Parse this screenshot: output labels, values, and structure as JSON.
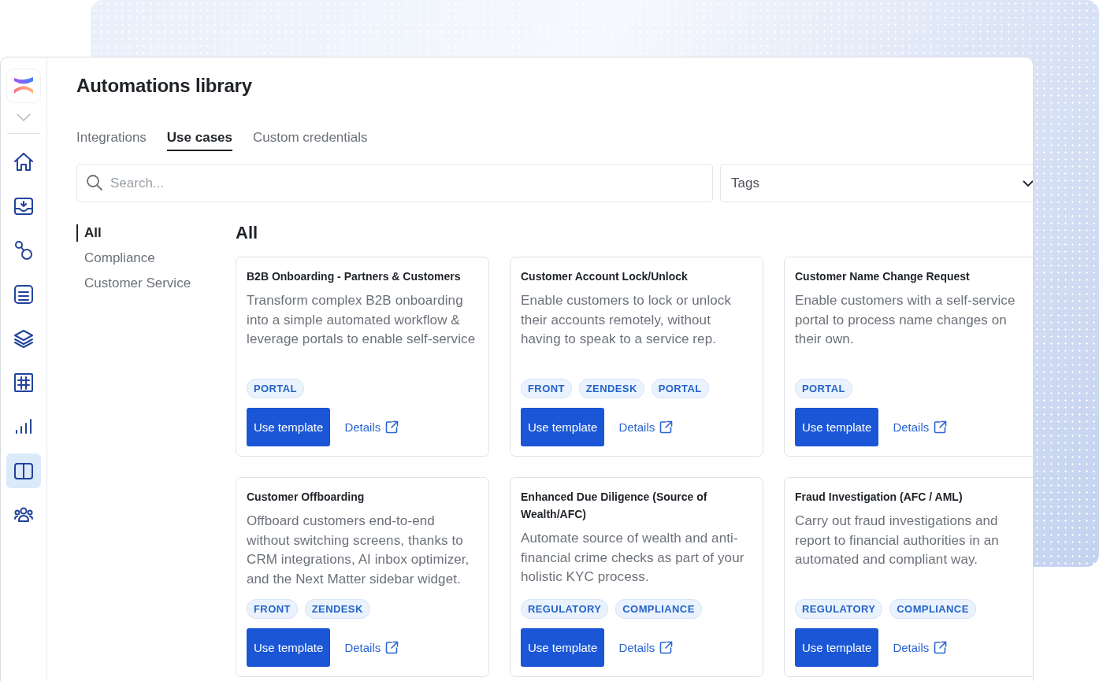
{
  "sidebar": {
    "items": [
      {
        "kind": "home",
        "selected": false
      },
      {
        "kind": "inbox",
        "selected": false
      },
      {
        "kind": "flow",
        "selected": false
      },
      {
        "kind": "list",
        "selected": false
      },
      {
        "kind": "layers",
        "selected": false
      },
      {
        "kind": "grid",
        "selected": false
      },
      {
        "kind": "chart",
        "selected": false
      },
      {
        "kind": "book",
        "selected": true
      },
      {
        "kind": "team",
        "selected": false
      }
    ]
  },
  "title": "Automations library",
  "tabs": [
    {
      "label": "Integrations",
      "selected": false
    },
    {
      "label": "Use cases",
      "selected": true
    },
    {
      "label": "Custom credentials",
      "selected": false
    }
  ],
  "search": {
    "placeholder": "Search..."
  },
  "tags_filter": {
    "label": "Tags"
  },
  "categories": [
    {
      "label": "All",
      "selected": true
    },
    {
      "label": "Compliance",
      "selected": false
    },
    {
      "label": "Customer Service",
      "selected": false
    }
  ],
  "section_title": "All",
  "cards": [
    {
      "title": "B2B Onboarding - Partners & Customers",
      "description": "Transform complex B2B onboarding into a simple automated workflow & leverage portals to enable self-service",
      "tags": [
        "PORTAL"
      ],
      "button": "Use template",
      "link": "Details"
    },
    {
      "title": "Customer Account Lock/Unlock",
      "description": "Enable customers to lock or unlock their accounts remotely, without having to speak to a service rep.",
      "tags": [
        "FRONT",
        "ZENDESK",
        "PORTAL"
      ],
      "button": "Use template",
      "link": "Details"
    },
    {
      "title": "Customer Name Change Request",
      "description": "Enable customers with a self-service portal to process name changes on their own.",
      "tags": [
        "PORTAL"
      ],
      "button": "Use template",
      "link": "Details"
    },
    {
      "title": "Customer Offboarding",
      "description": "Offboard customers end-to-end without switching screens, thanks to CRM integrations, AI inbox optimizer, and the Next Matter sidebar widget.",
      "tags": [
        "FRONT",
        "ZENDESK"
      ],
      "button": "Use template",
      "link": "Details"
    },
    {
      "title": "Enhanced Due Diligence (Source of Wealth/AFC)",
      "description": "Automate source of wealth and anti-financial crime checks as part of your holistic KYC process.",
      "tags": [
        "REGULATORY",
        "COMPLIANCE"
      ],
      "button": "Use template",
      "link": "Details"
    },
    {
      "title": "Fraud Investigation (AFC / AML)",
      "description": "Carry out fraud investigations and report to financial authorities in an automated and compliant way.",
      "tags": [
        "REGULATORY",
        "COMPLIANCE"
      ],
      "button": "Use template",
      "link": "Details"
    }
  ]
}
